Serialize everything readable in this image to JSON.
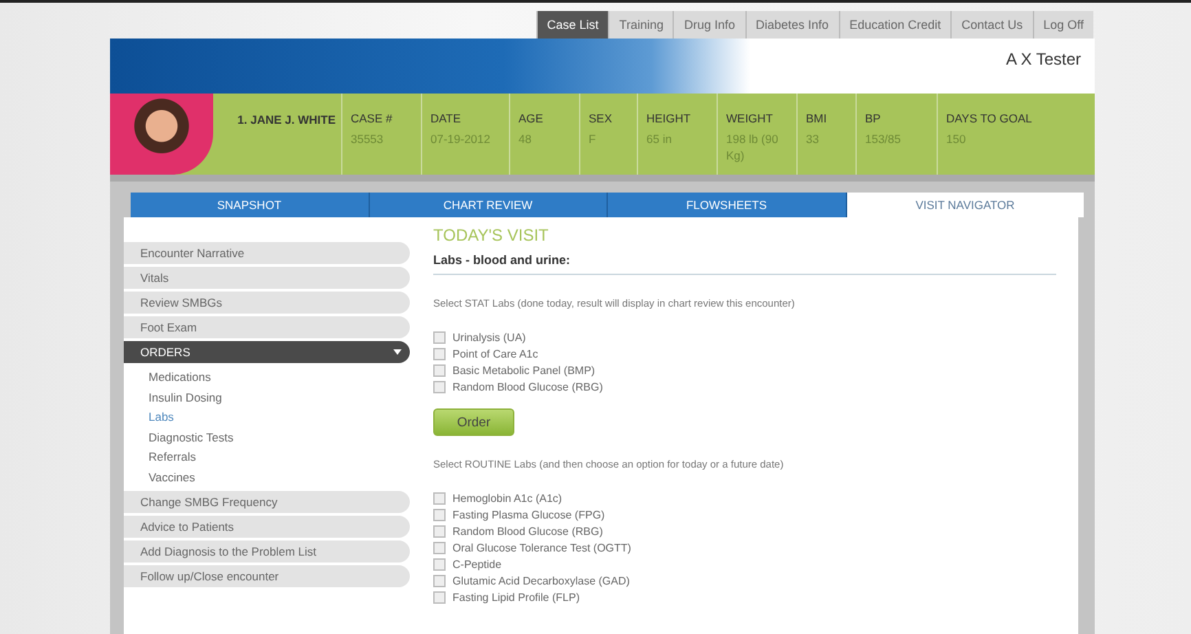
{
  "nav": [
    {
      "label": "Case List",
      "selected": true
    },
    {
      "label": "Training",
      "selected": false
    },
    {
      "label": "Drug Info",
      "selected": false
    },
    {
      "label": "Diabetes Info",
      "selected": false
    },
    {
      "label": "Education Credit",
      "selected": false
    },
    {
      "label": "Contact Us",
      "selected": false
    },
    {
      "label": "Log Off",
      "selected": false
    }
  ],
  "user": "A X Tester",
  "patient": {
    "name": "1. JANE J. WHITE",
    "fields": [
      {
        "label": "CASE #",
        "value": "35553"
      },
      {
        "label": "DATE",
        "value": "07-19-2012"
      },
      {
        "label": "AGE",
        "value": "48"
      },
      {
        "label": "SEX",
        "value": "F"
      },
      {
        "label": "HEIGHT",
        "value": "65 in"
      },
      {
        "label": "WEIGHT",
        "value": "198 lb (90 Kg)"
      },
      {
        "label": "BMI",
        "value": "33"
      },
      {
        "label": "BP",
        "value": "153/85"
      },
      {
        "label": "DAYS TO GOAL",
        "value": "150"
      }
    ]
  },
  "tabs": [
    {
      "label": "SNAPSHOT",
      "selected": false
    },
    {
      "label": "CHART REVIEW",
      "selected": false
    },
    {
      "label": "FLOWSHEETS",
      "selected": false
    },
    {
      "label": "VISIT NAVIGATOR",
      "selected": true
    }
  ],
  "sidebar": {
    "items": [
      {
        "label": "Encounter Narrative",
        "expanded": false
      },
      {
        "label": "Vitals",
        "expanded": false
      },
      {
        "label": "Review SMBGs",
        "expanded": false
      },
      {
        "label": "Foot Exam",
        "expanded": false
      },
      {
        "label": "ORDERS",
        "expanded": true,
        "children": [
          {
            "label": "Medications",
            "selected": false
          },
          {
            "label": "Insulin Dosing",
            "selected": false
          },
          {
            "label": "Labs",
            "selected": true
          },
          {
            "label": "Diagnostic Tests",
            "selected": false
          },
          {
            "label": "Referrals",
            "selected": false
          },
          {
            "label": "Vaccines",
            "selected": false
          }
        ]
      },
      {
        "label": "Change SMBG Frequency",
        "expanded": false
      },
      {
        "label": "Advice to Patients",
        "expanded": false
      },
      {
        "label": "Add Diagnosis to the Problem List",
        "expanded": false
      },
      {
        "label": "Follow up/Close encounter",
        "expanded": false
      }
    ]
  },
  "main": {
    "heading": "TODAY'S VISIT",
    "section_title": "Labs - blood and urine:",
    "groups": [
      {
        "instruction": "Select STAT Labs (done today, result will display in chart review this encounter)",
        "options": [
          {
            "label": "Urinalysis (UA)",
            "checked": false
          },
          {
            "label": "Point of Care A1c",
            "checked": false
          },
          {
            "label": "Basic Metabolic Panel (BMP)",
            "checked": false
          },
          {
            "label": "Random Blood Glucose (RBG)",
            "checked": false
          }
        ],
        "button": "Order"
      },
      {
        "instruction": "Select ROUTINE Labs (and then choose an option for today or a future date)",
        "options": [
          {
            "label": "Hemoglobin A1c (A1c)",
            "checked": false
          },
          {
            "label": "Fasting Plasma Glucose (FPG)",
            "checked": false
          },
          {
            "label": "Random Blood Glucose (RBG)",
            "checked": false
          },
          {
            "label": "Oral Glucose Tolerance Test (OGTT)",
            "checked": false
          },
          {
            "label": "C-Peptide",
            "checked": false
          },
          {
            "label": "Glutamic Acid Decarboxylase (GAD)",
            "checked": false
          },
          {
            "label": "Fasting Lipid Profile (FLP)",
            "checked": false
          }
        ]
      }
    ]
  }
}
